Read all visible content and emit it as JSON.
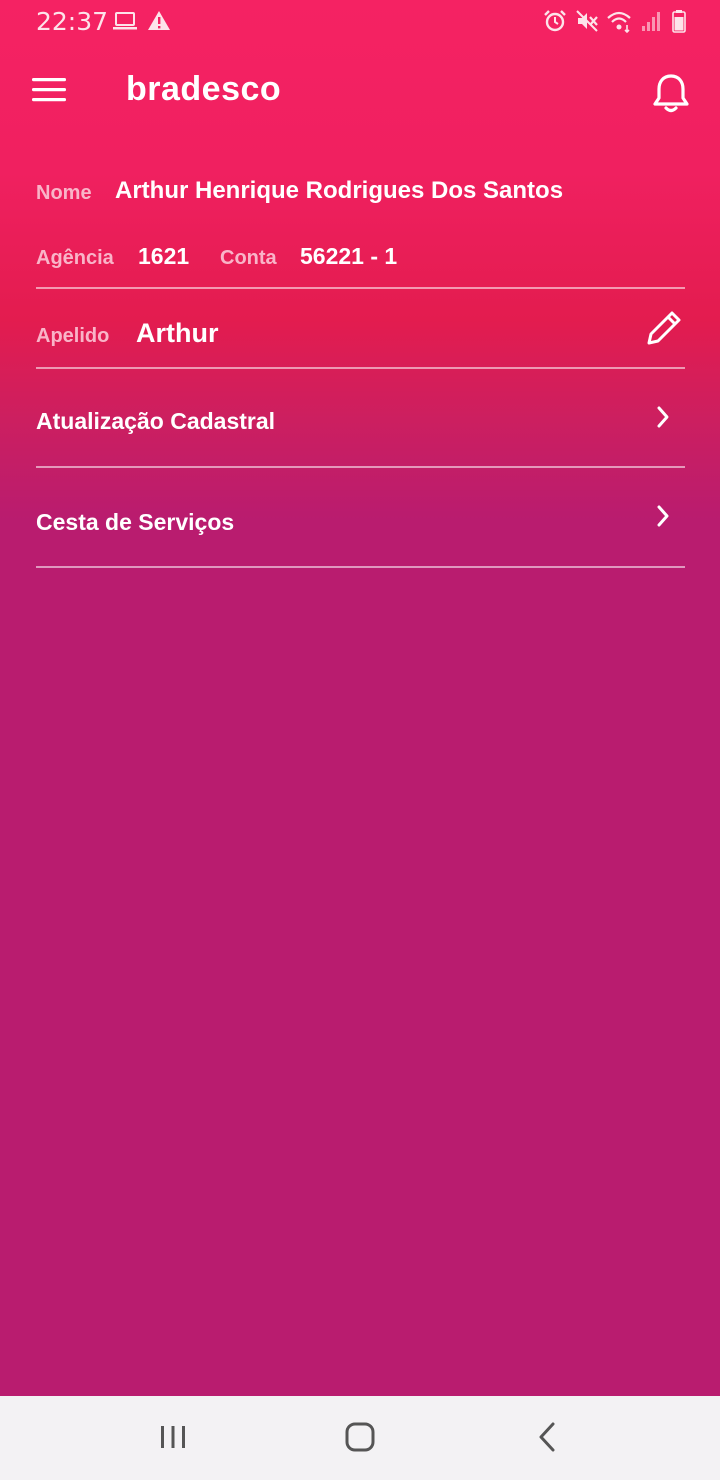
{
  "status_bar": {
    "time": "22:37",
    "icons": [
      "laptop-icon",
      "warning-icon",
      "alarm-icon",
      "mute-icon",
      "wifi-icon",
      "signal-icon",
      "battery-icon"
    ]
  },
  "app_bar": {
    "brand": "bradesco",
    "menu_icon": "hamburger-menu-icon",
    "notification_icon": "bell-icon"
  },
  "account": {
    "name_label": "Nome",
    "name_value": "Arthur Henrique Rodrigues Dos Santos",
    "agency_label": "Agência",
    "agency_value": "1621",
    "account_label": "Conta",
    "account_value": "56221 - 1",
    "nickname_label": "Apelido",
    "nickname_value": "Arthur",
    "edit_icon": "pencil-icon"
  },
  "menu_items": [
    {
      "label": "Atualização Cadastral",
      "icon": "chevron-right-icon"
    },
    {
      "label": "Cesta de Serviços",
      "icon": "chevron-right-icon"
    }
  ],
  "nav_bar": {
    "icons": [
      "recent-apps-icon",
      "home-icon",
      "back-icon"
    ]
  },
  "colors": {
    "top_gradient": "#f52263",
    "bottom_background": "#b91c6f",
    "label_pink": "#f9b4c8",
    "nav_bar_bg": "#f3f2f4"
  }
}
